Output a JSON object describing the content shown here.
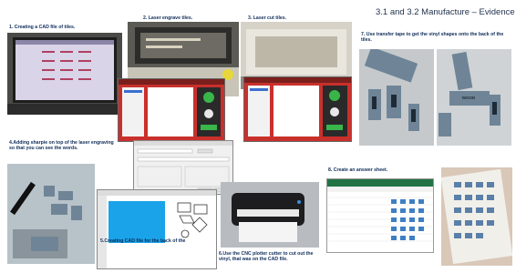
{
  "slide": {
    "title": "3.1 and 3.2 Manufacture – Evidence",
    "captions": {
      "step1": "1. Creating a CAD file of tiles.",
      "step2": "2. Laser engrave tiles.",
      "step3": "3. Laser cut tiles.",
      "step4": "4.Adding sharpie on top of the laser engraving so that you can see the words.",
      "step5": "5.Creating CAD file for the back of the",
      "step6": "6.Use the CNC plotter cutter to cut out the vinyl, that was on the CAD file.",
      "step7": "7. Use transfer tape to get the vinyl shapes onto the back of the tiles.",
      "step8": "8. Create an answer sheet."
    },
    "tile_label": "WOOD",
    "icons": [
      "laser-cutter-dialog-icon",
      "print-dialog-icon",
      "spreadsheet-icon"
    ]
  },
  "colors": {
    "title_text": "#1f2f4a",
    "caption_text": "#0f2d5a",
    "laser_red": "#c9302c",
    "cad_blue": "#1aa3e8",
    "slate_tile": "#6f8597",
    "excel_green": "#217346"
  }
}
